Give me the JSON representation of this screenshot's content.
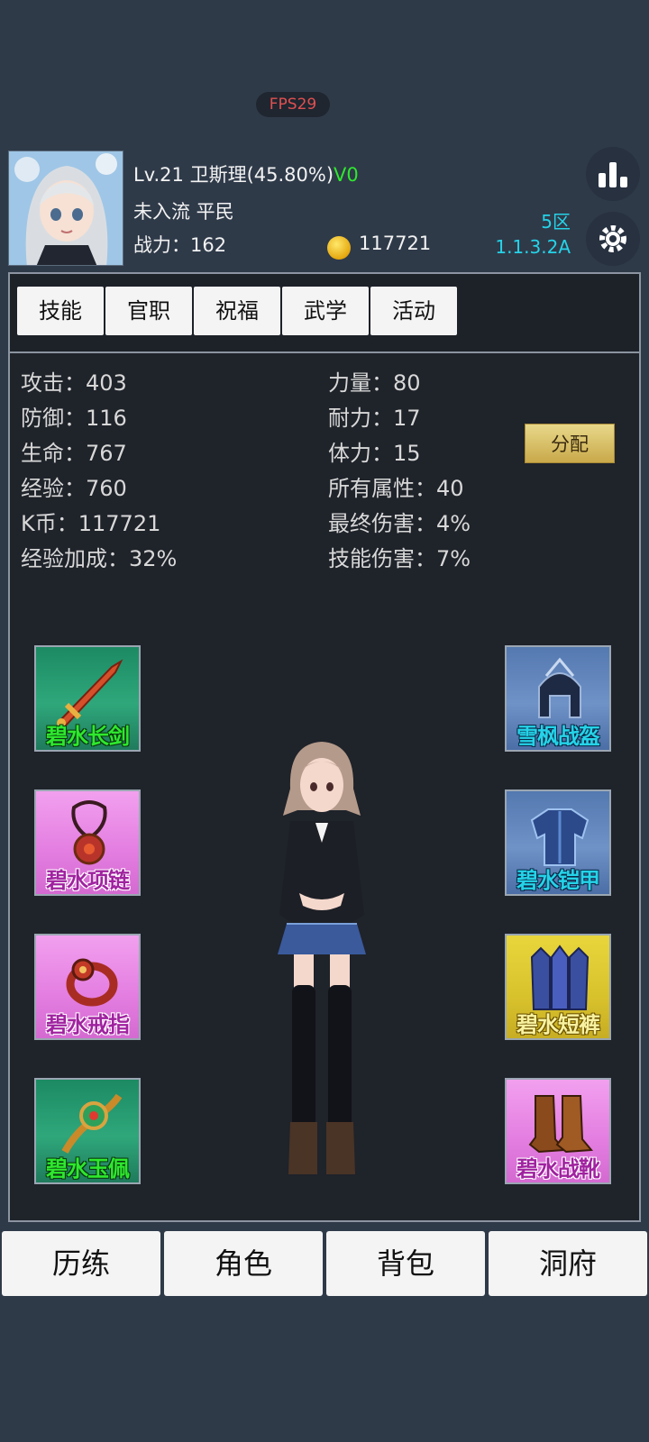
{
  "fps": "FPS29",
  "player": {
    "level_name": "Lv.21 卫斯理(45.80%)",
    "vip": "V0",
    "rank_line": "未入流 平民",
    "power_label": "战力：162",
    "coins": "117721"
  },
  "server": {
    "zone": "5区",
    "version": "1.1.3.2A"
  },
  "tabs": [
    "技能",
    "官职",
    "祝福",
    "武学",
    "活动"
  ],
  "stats_left": [
    "攻击：403",
    "防御：116",
    "生命：767",
    "经验：760",
    "K币：117721",
    "经验加成：32%"
  ],
  "stats_right": [
    "力量：80",
    "耐力：17",
    "体力：15",
    "所有属性：40",
    "最终伤害：4%",
    "技能伤害：7%"
  ],
  "assign_label": "分配",
  "equipment_left": [
    {
      "name": "碧水长剑",
      "rarity": "green",
      "icon": "sword-icon"
    },
    {
      "name": "碧水项链",
      "rarity": "pink",
      "icon": "necklace-icon"
    },
    {
      "name": "碧水戒指",
      "rarity": "pink",
      "icon": "ring-icon"
    },
    {
      "name": "碧水玉佩",
      "rarity": "green",
      "icon": "jade-pendant-icon"
    }
  ],
  "equipment_right": [
    {
      "name": "雪枫战盔",
      "rarity": "blue",
      "icon": "helmet-icon"
    },
    {
      "name": "碧水铠甲",
      "rarity": "blue",
      "icon": "armor-icon"
    },
    {
      "name": "碧水短裤",
      "rarity": "yellow",
      "icon": "leg-armor-icon"
    },
    {
      "name": "碧水战靴",
      "rarity": "pink",
      "icon": "boots-icon"
    }
  ],
  "bottom_nav": [
    "历练",
    "角色",
    "背包",
    "洞府"
  ],
  "colors": {
    "background": "#2f3a49",
    "panel": "#1f232a",
    "vip_green": "#2ee82e",
    "server_cyan": "#25d3e8",
    "fps_red": "#e05050"
  }
}
